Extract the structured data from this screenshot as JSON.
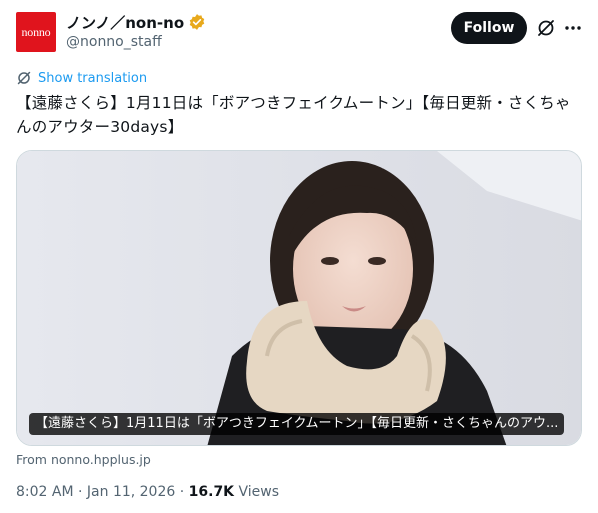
{
  "author": {
    "avatar_text": "nonno",
    "display_name": "ノンノ／non-no",
    "handle": "@nonno_staff",
    "verified": true,
    "verified_color": "#e8a91c"
  },
  "actions": {
    "follow_label": "Follow"
  },
  "translate": {
    "label": "Show translation"
  },
  "tweet": {
    "text": "【遠藤さくら】1月11日は「ボアつきフェイクムートン」【毎日更新・さくちゃんのアウター30days】"
  },
  "media": {
    "caption": "【遠藤さくら】1月11日は「ボアつきフェイクムートン」【毎日更新・さくちゃんのアウ..."
  },
  "link_source": "From nonno.hpplus.jp",
  "meta": {
    "time": "8:02 AM",
    "date": "Jan 11, 2026",
    "separator": "·",
    "views_count": "16.7K",
    "views_label": "Views"
  },
  "colors": {
    "brand_red": "#e0141d",
    "link_blue": "#1d9bf0",
    "text_secondary": "#536471"
  },
  "icons": {
    "verified": "verified-badge-icon",
    "grok": "grok-icon",
    "more": "more-icon",
    "translate": "translate-icon"
  }
}
